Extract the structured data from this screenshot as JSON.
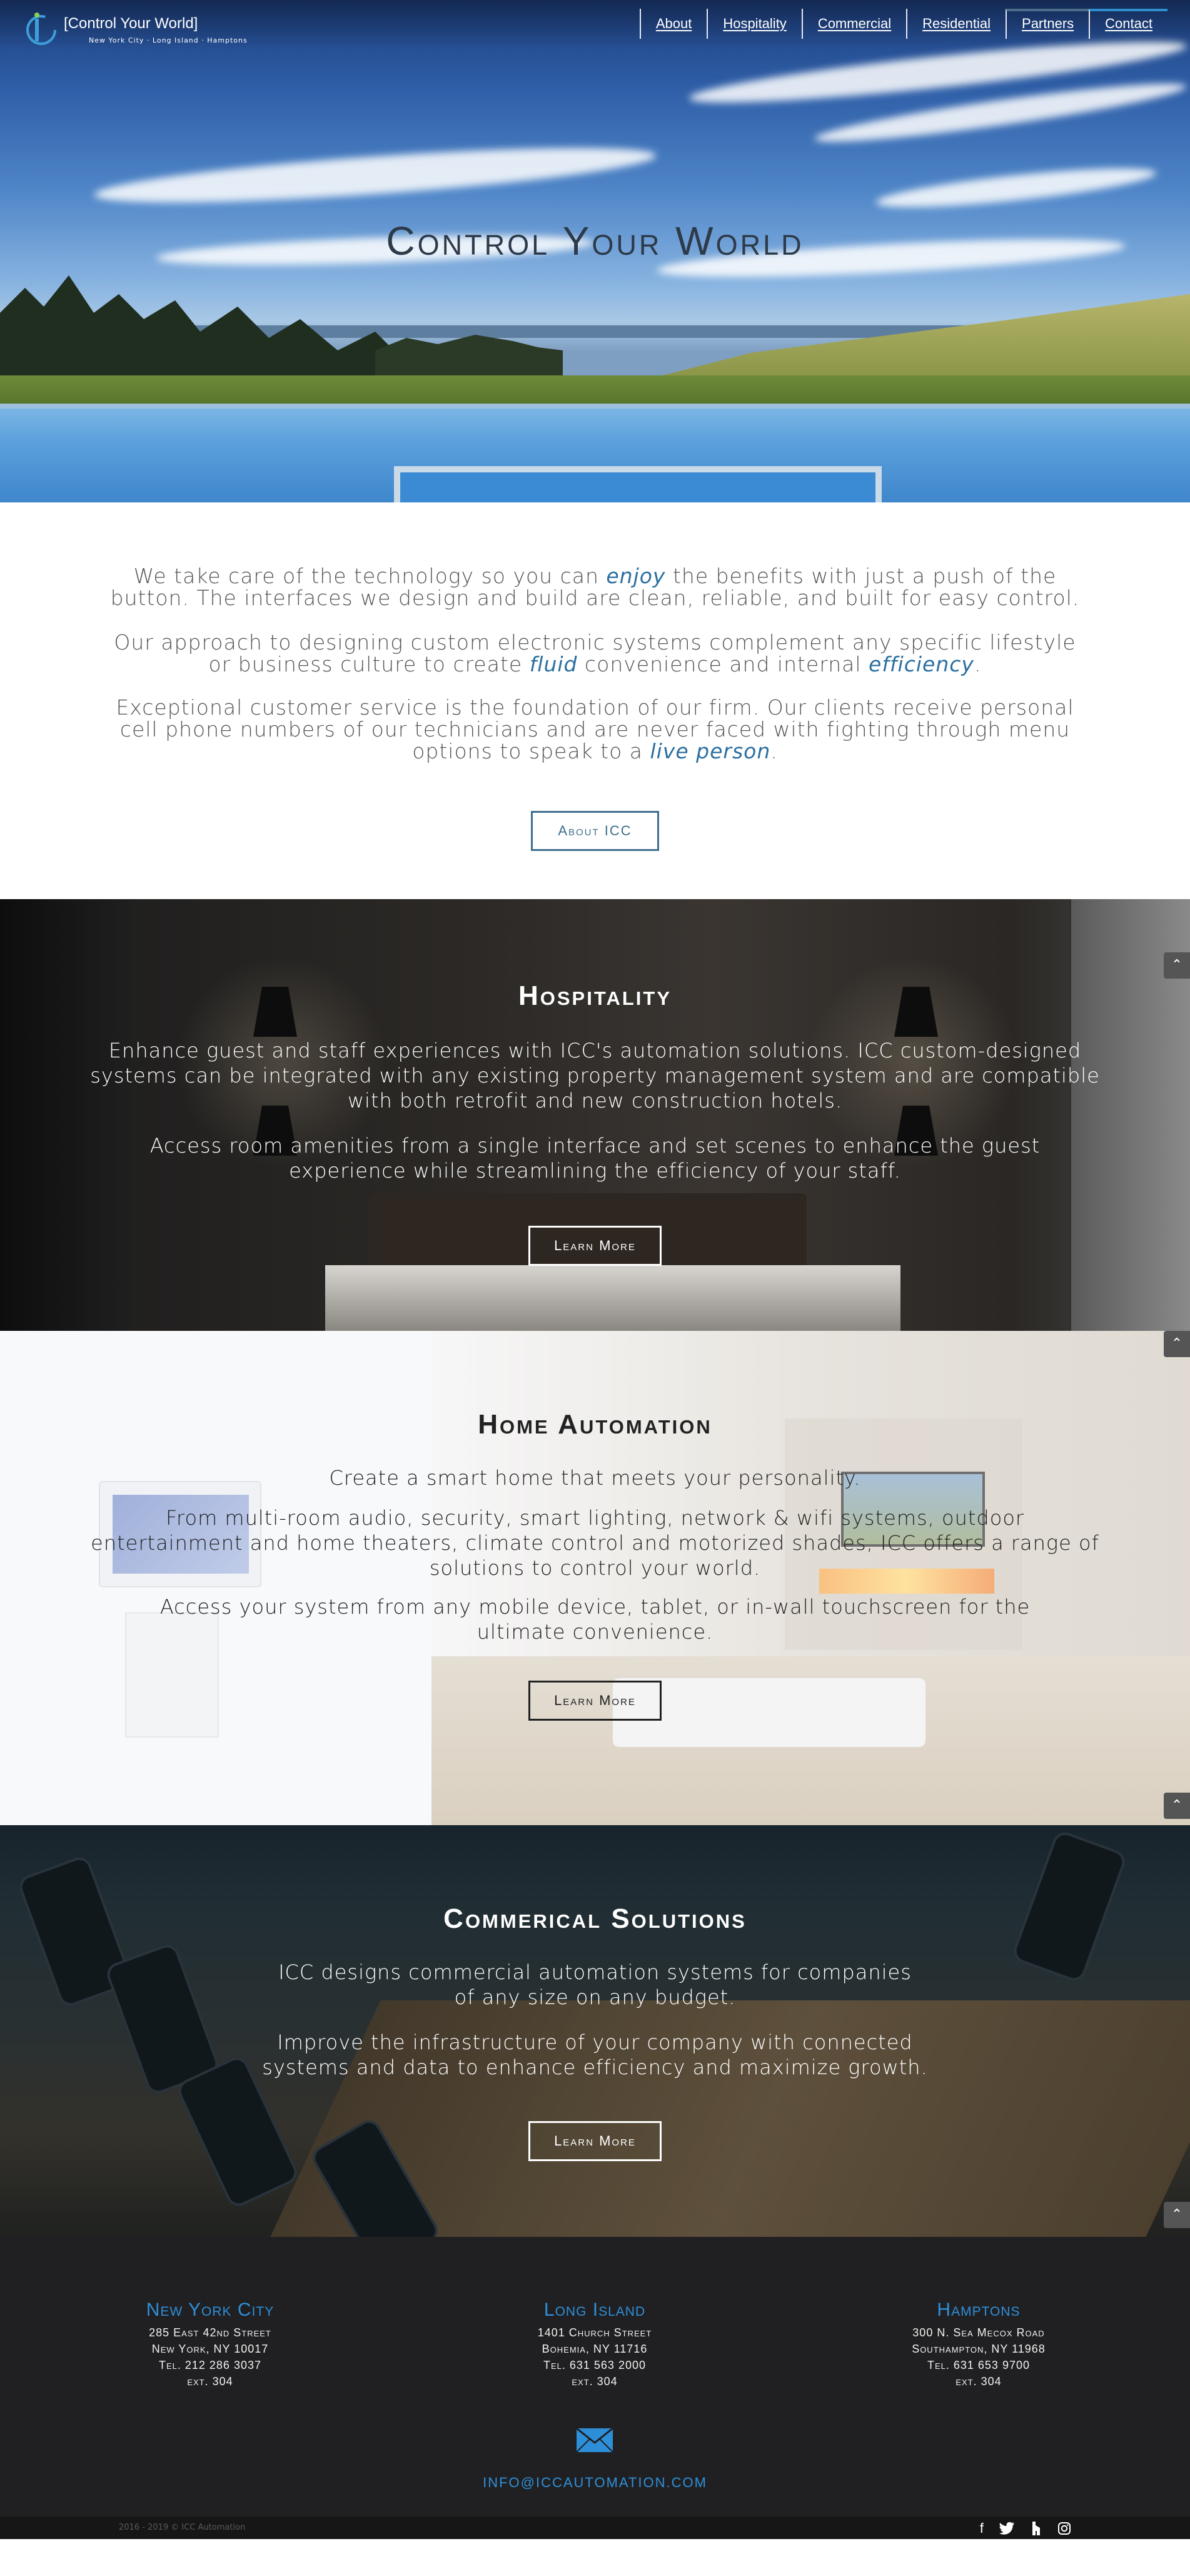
{
  "header": {
    "tagline": "[Control Your World]",
    "locations": "New York City · Long Island · Hamptons",
    "nav": [
      "About",
      "Hospitality",
      "Commercial",
      "Residential",
      "Partners",
      "Contact"
    ]
  },
  "hero": {
    "title": "Control Your World"
  },
  "intro": {
    "p1_a": "We take care of the technology so you can ",
    "p1_em": "enjoy",
    "p1_b": " the benefits with just a push of the button. The interfaces we design and build are clean, reliable, and built for easy control.",
    "p2_a": "Our approach to designing custom electronic systems complement any specific lifestyle or business culture to create ",
    "p2_em1": "fluid",
    "p2_b": " convenience and internal ",
    "p2_em2": "efficiency",
    "p2_c": ".",
    "p3_a": "Exceptional customer service is the foundation of our firm. Our clients receive personal cell phone numbers of our technicians and are never faced with fighting through menu options to speak to a ",
    "p3_em": "live person",
    "p3_b": ".",
    "button": "About ICC"
  },
  "hospitality": {
    "title": "Hospitality",
    "p1": "Enhance guest and staff experiences with ICC's automation solutions. ICC custom-designed systems can be integrated with any existing property management system and are compatible with both retrofit and new construction hotels.",
    "p2": "Access room amenities from a single interface and set scenes to enhance the guest experience while streamlining the efficiency of your staff.",
    "button": "Learn More"
  },
  "home": {
    "title": "Home Automation",
    "p1": "Create a smart home that meets your personality.",
    "p2": "From multi-room audio, security, smart lighting, network & wifi systems, outdoor entertainment and home theaters, climate control and motorized shades, ICC offers a range of solutions to control your world.",
    "p3": "Access your system from any mobile device, tablet, or in-wall touchscreen for the ultimate convenience.",
    "button": "Learn More"
  },
  "commercial": {
    "title": "Commerical Solutions",
    "p1": "ICC designs commercial automation systems for companies of any size on any budget.",
    "p2": "Improve the infrastructure of your company with connected systems and data to enhance efficiency and maximize growth.",
    "button": "Learn More"
  },
  "footer": {
    "offices": [
      {
        "name": "New York City",
        "street": "285 East 42nd Street",
        "city": "New York, NY 10017",
        "tel": "Tel. 212 286 3037",
        "ext": "ext. 304"
      },
      {
        "name": "Long Island",
        "street": "1401 Church Street",
        "city": "Bohemia, NY 11716",
        "tel": "Tel. 631 563 2000",
        "ext": "ext. 304"
      },
      {
        "name": "Hamptons",
        "street": "300 N. Sea Mecox Road",
        "city": "Southampton, NY 11968",
        "tel": "Tel. 631 653 9700",
        "ext": "ext. 304"
      }
    ],
    "email": "INFO@ICCAUTOMATION.COM",
    "copyright": "2016 - 2019 © ICC Automation",
    "social": [
      "facebook-icon",
      "twitter-icon",
      "houzz-icon",
      "instagram-icon"
    ]
  },
  "colors": {
    "accent": "#2e8fd9",
    "button_outline": "#3f6f8f",
    "footer_bg": "#202022"
  }
}
